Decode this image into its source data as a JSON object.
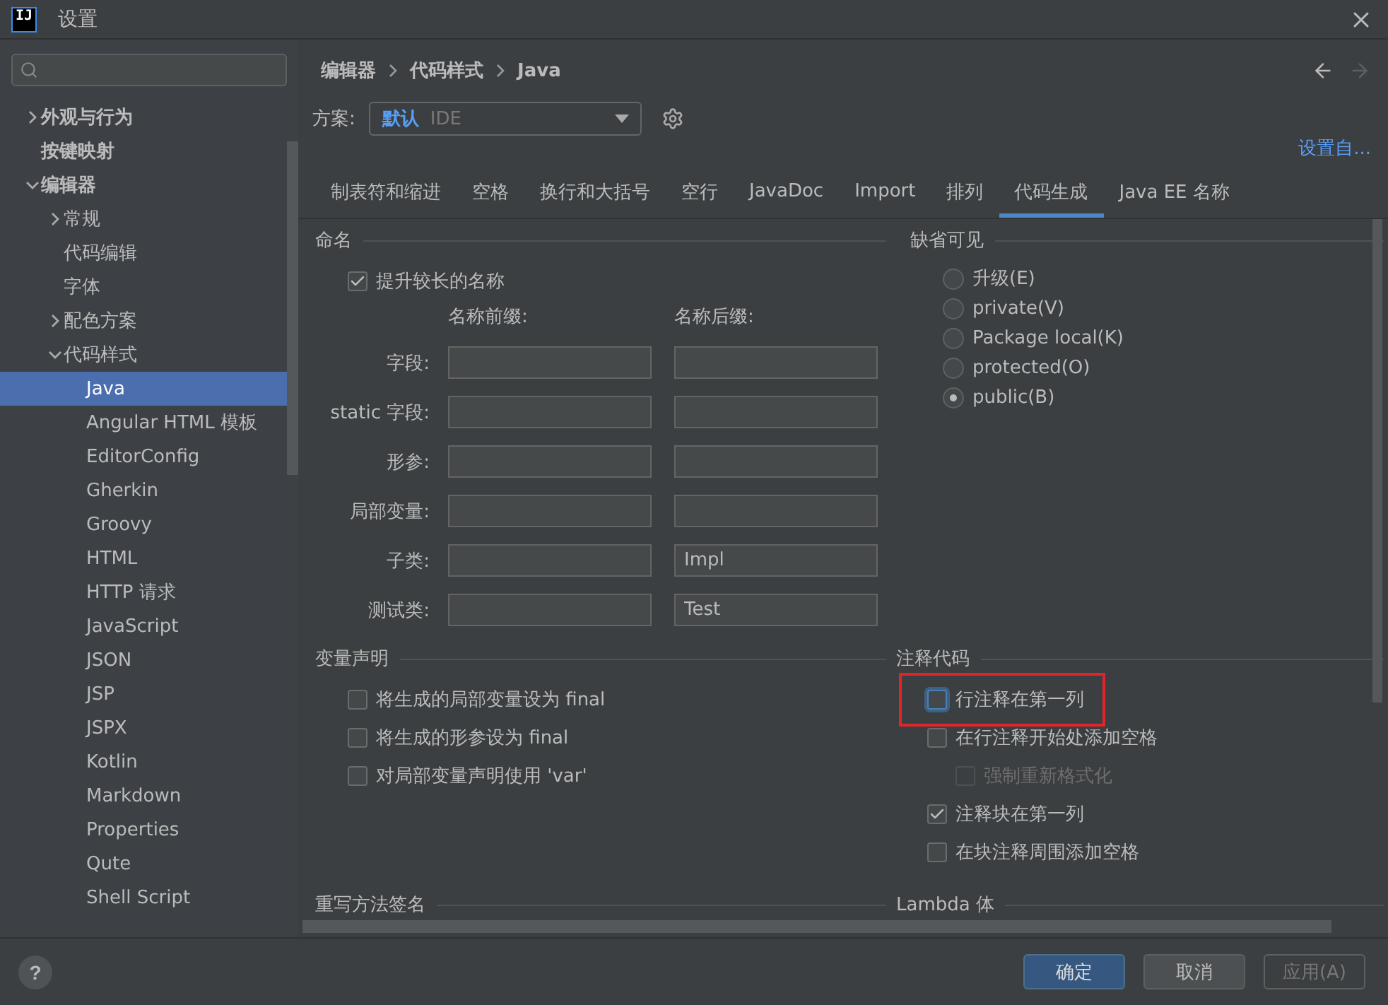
{
  "window": {
    "logo": "IJ",
    "title": "设置"
  },
  "sidebar": {
    "tree": [
      {
        "label": "外观与行为",
        "expanded": false,
        "selected": false
      },
      {
        "label": "按键映射",
        "selected": false
      },
      {
        "label": "编辑器",
        "expanded": true,
        "selected": false,
        "children": [
          {
            "label": "常规",
            "expanded": false,
            "selected": false
          },
          {
            "label": "代码编辑",
            "selected": false
          },
          {
            "label": "字体",
            "selected": false
          },
          {
            "label": "配色方案",
            "expanded": false,
            "selected": false
          },
          {
            "label": "代码样式",
            "expanded": true,
            "selected": false,
            "children": [
              {
                "label": "Java",
                "selected": true
              },
              {
                "label": "Angular HTML 模板",
                "selected": false
              },
              {
                "label": "EditorConfig",
                "selected": false
              },
              {
                "label": "Gherkin",
                "selected": false
              },
              {
                "label": "Groovy",
                "selected": false
              },
              {
                "label": "HTML",
                "selected": false
              },
              {
                "label": "HTTP 请求",
                "selected": false
              },
              {
                "label": "JavaScript",
                "selected": false
              },
              {
                "label": "JSON",
                "selected": false
              },
              {
                "label": "JSP",
                "selected": false
              },
              {
                "label": "JSPX",
                "selected": false
              },
              {
                "label": "Kotlin",
                "selected": false
              },
              {
                "label": "Markdown",
                "selected": false
              },
              {
                "label": "Properties",
                "selected": false
              },
              {
                "label": "Qute",
                "selected": false
              },
              {
                "label": "Shell Script",
                "selected": false
              }
            ]
          }
        ]
      }
    ]
  },
  "breadcrumb": [
    "编辑器",
    "代码样式",
    "Java"
  ],
  "nav": [
    {
      "kind": "back",
      "disabled": false
    },
    {
      "kind": "forward",
      "disabled": true
    }
  ],
  "scheme": {
    "label": "方案:",
    "name": "默认",
    "type": "IDE"
  },
  "set_from_link": "设置自...",
  "tabs": [
    {
      "label": "制表符和缩进",
      "selected": false
    },
    {
      "label": "空格",
      "selected": false
    },
    {
      "label": "换行和大括号",
      "selected": false
    },
    {
      "label": "空行",
      "selected": false
    },
    {
      "label": "JavaDoc",
      "selected": false
    },
    {
      "label": "Import",
      "selected": false
    },
    {
      "label": "排列",
      "selected": false
    },
    {
      "label": "代码生成",
      "selected": true
    },
    {
      "label": "Java EE 名称",
      "selected": false
    }
  ],
  "naming": {
    "title": "命名",
    "option": {
      "label": "提升较长的名称",
      "checked": true
    },
    "prefix_header": "名称前缀:",
    "suffix_header": "名称后缀:",
    "rows": [
      {
        "label": "字段:"
      },
      {
        "label": "static 字段:"
      },
      {
        "label": "形参:"
      },
      {
        "label": "局部变量:"
      },
      {
        "label": "子类:",
        "suffix": "Impl"
      },
      {
        "label": "测试类:",
        "suffix": "Test"
      }
    ]
  },
  "default_visibility": {
    "title": "缺省可见",
    "options": [
      {
        "label": "升级(E)",
        "selected": false
      },
      {
        "label": "private(V)",
        "selected": false
      },
      {
        "label": "Package local(K)",
        "selected": false
      },
      {
        "label": "protected(O)",
        "selected": false
      },
      {
        "label": "public(B)",
        "selected": true
      }
    ]
  },
  "variable_declaration": {
    "title": "变量声明",
    "options": [
      {
        "label": "将生成的局部变量设为 final",
        "checked": false
      },
      {
        "label": "将生成的形参设为 final",
        "checked": false
      },
      {
        "label": "对局部变量声明使用 'var'",
        "checked": false
      }
    ]
  },
  "comment_code": {
    "title": "注释代码",
    "options": [
      {
        "label": "行注释在第一列",
        "checked": false,
        "highlighted": true
      },
      {
        "label": "在行注释开始处添加空格",
        "checked": false,
        "children": [
          {
            "label": "强制重新格式化",
            "checked": false,
            "disabled": true
          }
        ]
      },
      {
        "label": "注释块在第一列",
        "checked": true
      },
      {
        "label": "在块注释周围添加空格",
        "checked": false
      }
    ]
  },
  "override_signature": {
    "title": "重写方法签名"
  },
  "lambda_body": {
    "title": "Lambda 体"
  },
  "help": "?",
  "buttons": [
    {
      "label": "确定",
      "kind": "primary",
      "disabled": false
    },
    {
      "label": "取消",
      "kind": "normal",
      "disabled": false
    },
    {
      "label": "应用(A)",
      "kind": "normal",
      "disabled": true
    }
  ]
}
